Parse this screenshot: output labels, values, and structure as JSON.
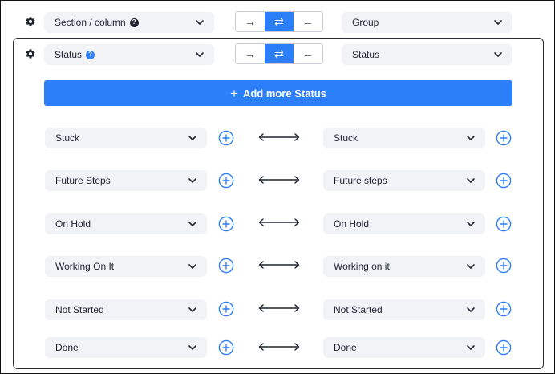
{
  "top": {
    "section_column_label": "Section / column",
    "group_label": "Group",
    "direction_toggle": [
      "→",
      "⇄",
      "←"
    ]
  },
  "panel": {
    "status_left_label": "Status",
    "status_right_label": "Status",
    "direction_toggle": [
      "→",
      "⇄",
      "←"
    ],
    "add_button_label": "Add more Status",
    "mappings": [
      {
        "left": "Stuck",
        "right": "Stuck"
      },
      {
        "left": "Future Steps",
        "right": "Future steps"
      },
      {
        "left": "On Hold",
        "right": "On Hold"
      },
      {
        "left": "Working On It",
        "right": "Working on it"
      },
      {
        "left": "Not Started",
        "right": "Not Started"
      },
      {
        "left": "Done",
        "right": "Done"
      }
    ]
  },
  "colors": {
    "accent": "#2d7ff9",
    "select_bg": "#f1f3f6",
    "text": "#1f2430"
  },
  "icons": [
    "gear-icon",
    "help-icon",
    "chevron-down-icon",
    "plus-circle-icon",
    "double-arrow-icon",
    "arrow-right-icon",
    "swap-icon",
    "arrow-left-icon"
  ]
}
